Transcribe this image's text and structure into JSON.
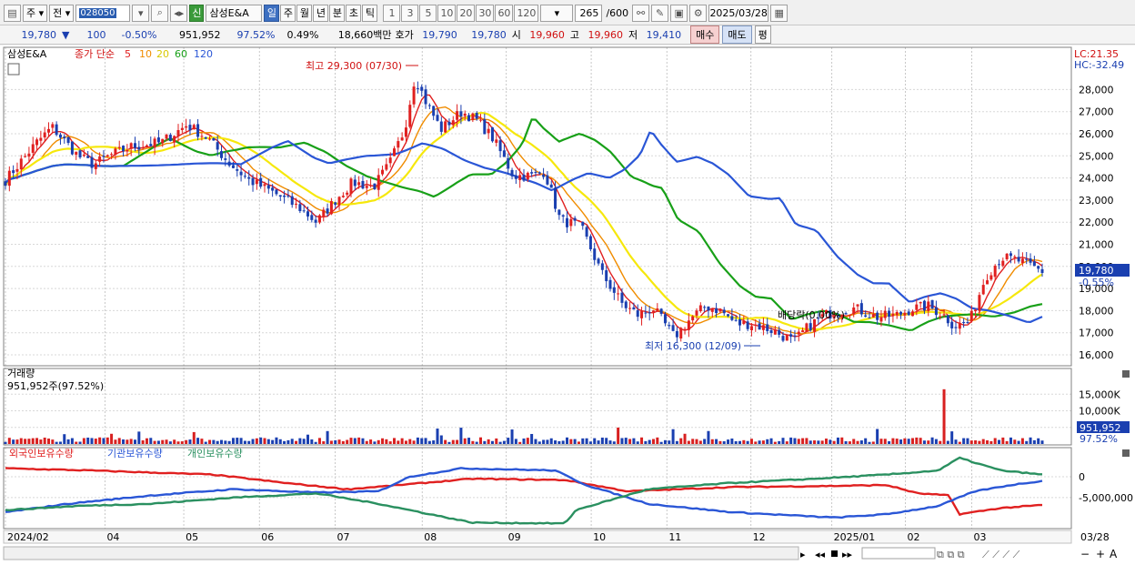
{
  "toolbar": {
    "mode_label": "주",
    "prev_label": "전",
    "stock_code": "028050",
    "sin_label": "신",
    "stock_name": "삼성E&A",
    "periods": [
      "일",
      "주",
      "월",
      "년",
      "분",
      "초",
      "틱"
    ],
    "active_period": "일",
    "intervals": [
      "1",
      "3",
      "5",
      "10",
      "20",
      "30",
      "60",
      "120"
    ],
    "count_value": "265",
    "count_total": "/600",
    "date_value": "2025/03/28"
  },
  "quote": {
    "price": "19,780",
    "change_arrow": "▼",
    "change": "100",
    "change_pct": "-0.50%",
    "volume": "951,952",
    "volume_ratio": "97.52%",
    "turnover_pct": "0.49%",
    "trade_amount": "18,660백만",
    "bid_label": "호가",
    "bid_price": "19,790",
    "ask_price": "19,780",
    "open_label": "시",
    "open": "19,960",
    "high_label": "고",
    "high": "19,960",
    "low_label": "저",
    "low": "19,410",
    "buy_label": "매수",
    "sell_label": "매도",
    "eval_label": "평"
  },
  "colors": {
    "candle_up": "#e02020",
    "candle_down": "#1a3fb0",
    "ma5": "#e02020",
    "ma10": "#f08c00",
    "ma20": "#f6e80c",
    "ma60": "#18a018",
    "ma120": "#2a56d6",
    "foreign": "#e02020",
    "institution": "#2a56d6",
    "individual": "#2a9060",
    "volume_bar": "#d82020"
  },
  "price_panel": {
    "name": "삼성E&A",
    "legend_prefix": "종가 단순",
    "ma_labels": [
      "5",
      "10",
      "20",
      "60",
      "120"
    ],
    "lc_label": "LC:21.35",
    "hc_label": "HC:-32.49",
    "current_price_label": "19,780",
    "current_change_label": "-0.55%",
    "high_annotation": "최고 29,300 (07/30)",
    "low_annotation": "최저 16,300 (12/09)",
    "dividend_annotation": "배당락(0.00%)",
    "y_ticks": [
      "16,000",
      "17,000",
      "18,000",
      "19,000",
      "20,000",
      "21,000",
      "22,000",
      "23,000",
      "24,000",
      "25,000",
      "26,000",
      "27,000",
      "28,000"
    ]
  },
  "volume_panel": {
    "title": "거래량",
    "subtitle": "951,952주(97.52%)",
    "y_ticks": [
      "5,000K",
      "10,000K",
      "15,000K"
    ],
    "current_label": "951,952",
    "current_pct": "97.52%"
  },
  "holdings_panel": {
    "titles": [
      "외국인보유수량",
      "기관보유수량",
      "개인보유수량"
    ],
    "y_ticks": [
      "0",
      "-5,000,000"
    ]
  },
  "x_axis": {
    "labels": [
      "2024/02",
      "04",
      "05",
      "06",
      "07",
      "08",
      "09",
      "10",
      "11",
      "12",
      "2025/01",
      "02",
      "03",
      "03/28"
    ]
  },
  "chart_data": {
    "type": "candlestick",
    "x_range": [
      "2024/02",
      "2025/03/28"
    ],
    "price_anchors": [
      [
        0,
        23900
      ],
      [
        0.03,
        25600
      ],
      [
        0.045,
        26300
      ],
      [
        0.07,
        25000
      ],
      [
        0.085,
        24600
      ],
      [
        0.1,
        25000
      ],
      [
        0.12,
        25400
      ],
      [
        0.15,
        25600
      ],
      [
        0.175,
        26400
      ],
      [
        0.195,
        25800
      ],
      [
        0.215,
        24700
      ],
      [
        0.235,
        23900
      ],
      [
        0.26,
        23300
      ],
      [
        0.285,
        22600
      ],
      [
        0.3,
        22000
      ],
      [
        0.32,
        23100
      ],
      [
        0.335,
        23800
      ],
      [
        0.355,
        23600
      ],
      [
        0.37,
        24600
      ],
      [
        0.385,
        26200
      ],
      [
        0.395,
        28600
      ],
      [
        0.405,
        27500
      ],
      [
        0.42,
        26200
      ],
      [
        0.44,
        27000
      ],
      [
        0.455,
        26600
      ],
      [
        0.47,
        25800
      ],
      [
        0.49,
        24100
      ],
      [
        0.51,
        24100
      ],
      [
        0.52,
        24300
      ],
      [
        0.535,
        22100
      ],
      [
        0.555,
        21800
      ],
      [
        0.575,
        19700
      ],
      [
        0.595,
        18300
      ],
      [
        0.61,
        17800
      ],
      [
        0.625,
        18100
      ],
      [
        0.645,
        16800
      ],
      [
        0.66,
        17600
      ],
      [
        0.675,
        18200
      ],
      [
        0.69,
        18000
      ],
      [
        0.705,
        17400
      ],
      [
        0.72,
        17400
      ],
      [
        0.74,
        17100
      ],
      [
        0.76,
        16600
      ],
      [
        0.775,
        17300
      ],
      [
        0.79,
        17800
      ],
      [
        0.805,
        18000
      ],
      [
        0.82,
        18100
      ],
      [
        0.84,
        17700
      ],
      [
        0.86,
        17800
      ],
      [
        0.875,
        18100
      ],
      [
        0.89,
        18200
      ],
      [
        0.905,
        17800
      ],
      [
        0.915,
        17300
      ],
      [
        0.93,
        17500
      ],
      [
        0.945,
        19500
      ],
      [
        0.96,
        20400
      ],
      [
        0.975,
        20300
      ],
      [
        1.0,
        19780
      ]
    ],
    "ma_params": [
      5,
      10,
      20,
      60,
      120
    ],
    "y_range_price": [
      16000,
      28000
    ],
    "annotations": {
      "high": {
        "value": 29300,
        "date": "07/30"
      },
      "low": {
        "value": 16300,
        "date": "12/09"
      }
    },
    "volume_spike_position": 0.905,
    "volume_spike_value": 16500000,
    "y_range_volume": [
      0,
      17000000
    ],
    "holdings": {
      "foreign": [
        [
          0,
          2000000
        ],
        [
          0.08,
          1500000
        ],
        [
          0.2,
          500000
        ],
        [
          0.27,
          -1500000
        ],
        [
          0.33,
          -3000000
        ],
        [
          0.38,
          -2000000
        ],
        [
          0.45,
          -500000
        ],
        [
          0.54,
          -800000
        ],
        [
          0.6,
          -3500000
        ],
        [
          0.7,
          -2500000
        ],
        [
          0.8,
          -2200000
        ],
        [
          0.85,
          -2000000
        ],
        [
          0.88,
          -4000000
        ],
        [
          0.91,
          -4500000
        ],
        [
          0.92,
          -9000000
        ],
        [
          0.96,
          -7500000
        ],
        [
          1.0,
          -6800000
        ]
      ],
      "institution": [
        [
          0,
          -8500000
        ],
        [
          0.06,
          -6500000
        ],
        [
          0.14,
          -4500000
        ],
        [
          0.22,
          -3000000
        ],
        [
          0.3,
          -3800000
        ],
        [
          0.36,
          -3500000
        ],
        [
          0.39,
          0
        ],
        [
          0.44,
          2000000
        ],
        [
          0.53,
          1500000
        ],
        [
          0.56,
          -2000000
        ],
        [
          0.62,
          -6500000
        ],
        [
          0.7,
          -8500000
        ],
        [
          0.8,
          -9800000
        ],
        [
          0.85,
          -9000000
        ],
        [
          0.9,
          -7000000
        ],
        [
          0.935,
          -3500000
        ],
        [
          0.97,
          -2000000
        ],
        [
          1.0,
          -1000000
        ]
      ],
      "individual": [
        [
          0,
          -8000000
        ],
        [
          0.07,
          -7000000
        ],
        [
          0.14,
          -6500000
        ],
        [
          0.22,
          -5000000
        ],
        [
          0.3,
          -4000000
        ],
        [
          0.36,
          -6500000
        ],
        [
          0.45,
          -11000000
        ],
        [
          0.54,
          -11200000
        ],
        [
          0.55,
          -8000000
        ],
        [
          0.62,
          -3000000
        ],
        [
          0.7,
          -1500000
        ],
        [
          0.78,
          -500000
        ],
        [
          0.85,
          500000
        ],
        [
          0.9,
          1500000
        ],
        [
          0.92,
          4500000
        ],
        [
          0.96,
          1500000
        ],
        [
          1.0,
          500000
        ]
      ],
      "y_range": [
        -12000000,
        5000000
      ]
    }
  }
}
